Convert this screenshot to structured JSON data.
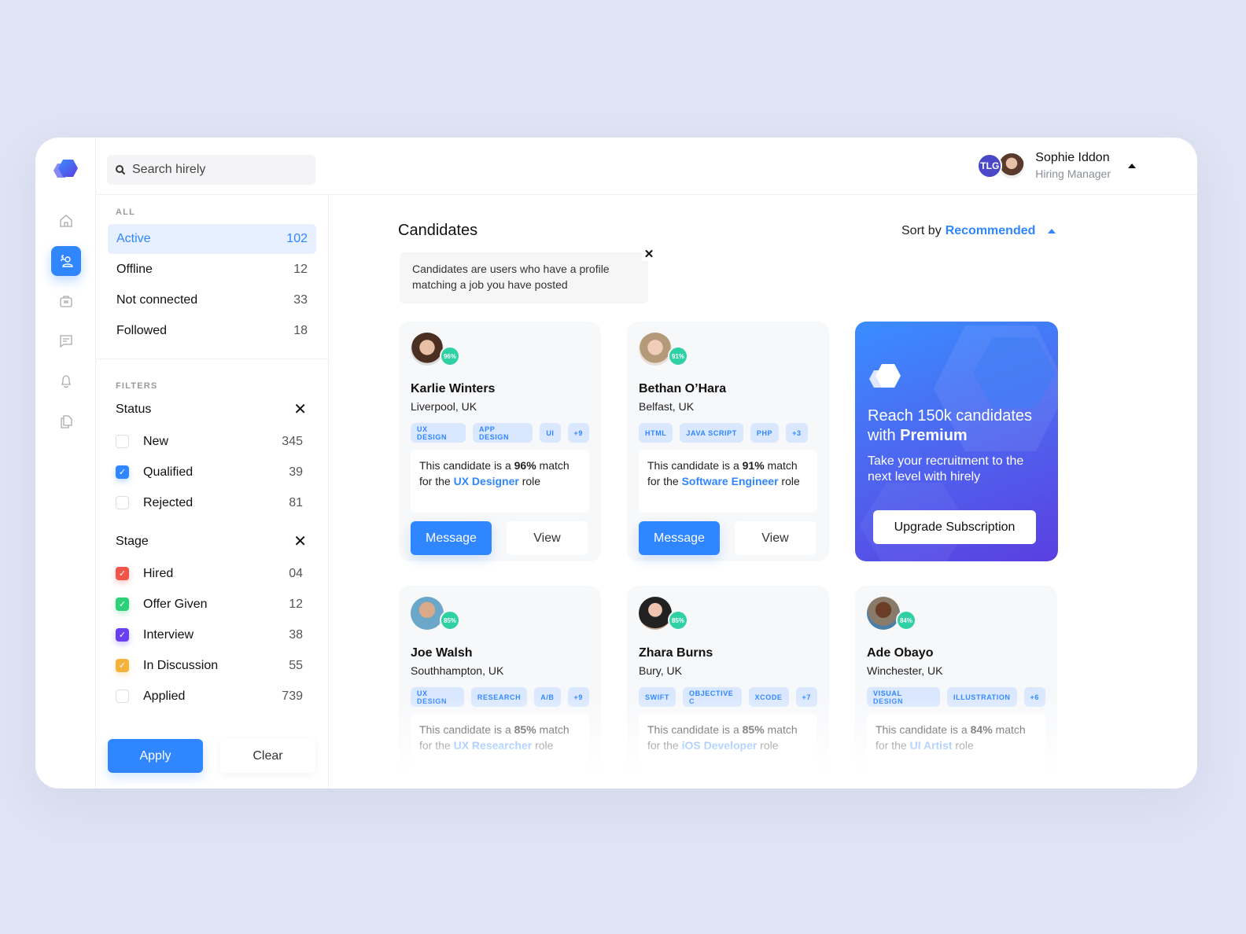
{
  "app": {
    "name": "hirely"
  },
  "search": {
    "placeholder": "Search hirely"
  },
  "user": {
    "initials": "TLG",
    "name": "Sophie Iddon",
    "role": "Hiring Manager"
  },
  "rail": [
    "home-icon",
    "candidates-icon",
    "jobs-icon",
    "messages-icon",
    "notifications-icon",
    "documents-icon"
  ],
  "sidebar": {
    "all_label": "ALL",
    "items": [
      {
        "label": "Active",
        "count": "102",
        "active": true
      },
      {
        "label": "Offline",
        "count": "12"
      },
      {
        "label": "Not connected",
        "count": "33"
      },
      {
        "label": "Followed",
        "count": "18"
      }
    ],
    "filters_label": "FILTERS",
    "status": {
      "title": "Status",
      "options": [
        {
          "label": "New",
          "count": "345",
          "checked": false
        },
        {
          "label": "Qualified",
          "count": "39",
          "checked": true,
          "color": "#2f86ff"
        },
        {
          "label": "Rejected",
          "count": "81",
          "checked": false
        }
      ]
    },
    "stage": {
      "title": "Stage",
      "options": [
        {
          "label": "Hired",
          "count": "04",
          "checked": true,
          "color": "#f0554a"
        },
        {
          "label": "Offer Given",
          "count": "12",
          "checked": true,
          "color": "#2ed07a"
        },
        {
          "label": "Interview",
          "count": "38",
          "checked": true,
          "color": "#6a3ff0"
        },
        {
          "label": "In Discussion",
          "count": "55",
          "checked": true,
          "color": "#f3b23c"
        },
        {
          "label": "Applied",
          "count": "739",
          "checked": false
        }
      ]
    },
    "apply_label": "Apply",
    "clear_label": "Clear"
  },
  "main": {
    "title": "Candidates",
    "sort_prefix": "Sort by",
    "sort_value": "Recommended",
    "info": "Candidates are users who have a profile matching a job you have posted",
    "info_close": "✕"
  },
  "candidates": [
    {
      "name": "Karlie Winters",
      "location": "Liverpool, UK",
      "match": "96%",
      "tags": [
        "UX DESIGN",
        "APP DESIGN",
        "UI",
        "+9"
      ],
      "text_pre": "This candidate is a ",
      "text_mid": " match for the ",
      "role": "UX Designer",
      "text_post": " role",
      "message": "Message",
      "view": "View"
    },
    {
      "name": "Bethan O’Hara",
      "location": "Belfast, UK",
      "match": "91%",
      "tags": [
        "HTML",
        "JAVA SCRIPT",
        "PHP",
        "+3"
      ],
      "text_pre": "This candidate is a ",
      "text_mid": " match for the ",
      "role": "Software Engineer",
      "text_post": " role",
      "message": "Message",
      "view": "View"
    },
    {
      "name": "Joe Walsh",
      "location": "Southhampton, UK",
      "match": "85%",
      "tags": [
        "UX DESIGN",
        "RESEARCH",
        "A/B",
        "+9"
      ],
      "text_pre": "This candidate is a ",
      "text_mid": " match for the ",
      "role": "UX Researcher",
      "text_post": " role"
    },
    {
      "name": "Zhara Burns",
      "location": "Bury, UK",
      "match": "85%",
      "tags": [
        "SWIFT",
        "OBJECTIVE C",
        "XCODE",
        "+7"
      ],
      "text_pre": "This candidate is a ",
      "text_mid": " match for the ",
      "role": "iOS Developer",
      "text_post": " role"
    },
    {
      "name": "Ade Obayo",
      "location": "Winchester, UK",
      "match": "84%",
      "tags": [
        "VISUAL DESIGN",
        "ILLUSTRATION",
        "+6"
      ],
      "text_pre": "This candidate is a ",
      "text_mid": " match for the ",
      "role": "UI Artist",
      "text_post": " role"
    }
  ],
  "promo": {
    "headline_pre": "Reach 150k candidates with ",
    "headline_bold": "Premium",
    "subtitle": "Take your recruitment to the next level with hirely",
    "button": "Upgrade Subscription"
  },
  "colors": {
    "accent": "#2f86ff",
    "match_badge": "#2fd0a4",
    "tlg": "#4a48c7"
  }
}
